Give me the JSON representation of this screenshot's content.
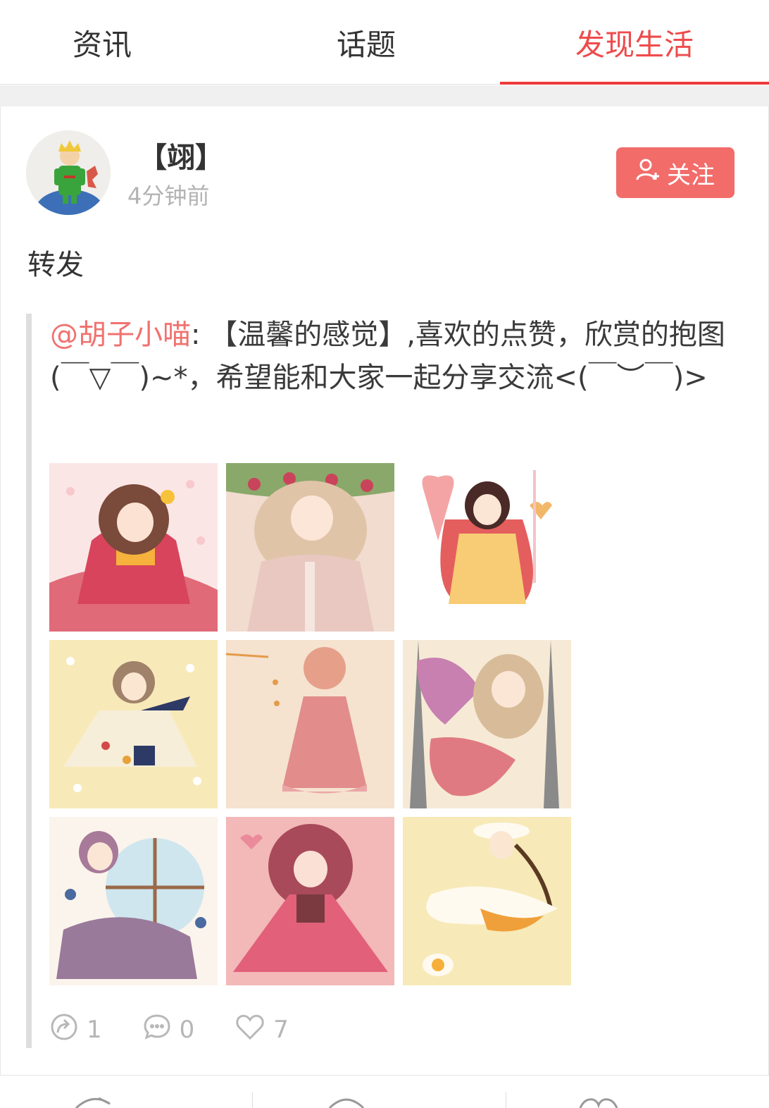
{
  "tabs": {
    "items": [
      {
        "label": "资讯"
      },
      {
        "label": "话题"
      },
      {
        "label": "发现生活"
      }
    ],
    "active_index": 2,
    "active_color": "#ee4b4b"
  },
  "post": {
    "username": "【翊】",
    "time": "4分钟前",
    "follow_label": "关注",
    "follow_color": "#f26c6a",
    "text": "转发",
    "quote": {
      "mention": "@胡子小喵",
      "separator": ":",
      "text": " 【温馨的感觉】,喜欢的点赞，欣赏的抱图(￣▽￣)~*，希望能和大家一起分享交流<(￣︶￣)>"
    },
    "images": [
      {
        "name": "girl-kimono-happy"
      },
      {
        "name": "girl-strawberry-hair"
      },
      {
        "name": "girl-red-hood"
      },
      {
        "name": "girl-flower-dress"
      },
      {
        "name": "girl-spoon-honey"
      },
      {
        "name": "girl-strawberry-petal"
      },
      {
        "name": "girl-window-lavender"
      },
      {
        "name": "girl-pink-ballgown"
      },
      {
        "name": "girl-egg-hat"
      }
    ],
    "stats": {
      "shares": "1",
      "comments": "0",
      "likes": "7"
    }
  },
  "icons": {
    "follow": "add-user-icon",
    "share": "share-icon",
    "comment": "comment-icon",
    "like": "heart-icon"
  }
}
